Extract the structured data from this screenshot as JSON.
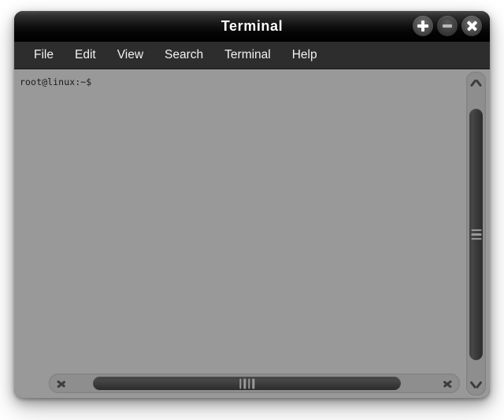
{
  "window": {
    "title": "Terminal",
    "controls": [
      {
        "name": "maximize-button",
        "icon": "plus-icon",
        "label": "+"
      },
      {
        "name": "minimize-button",
        "icon": "minus-icon",
        "label": "−"
      },
      {
        "name": "close-button",
        "icon": "close-icon",
        "label": "✕"
      }
    ]
  },
  "menubar": {
    "items": [
      {
        "label": "File"
      },
      {
        "label": "Edit"
      },
      {
        "label": "View"
      },
      {
        "label": "Search"
      },
      {
        "label": "Terminal"
      },
      {
        "label": "Help"
      }
    ]
  },
  "terminal": {
    "prompt": "root@linux:~$",
    "background_color": "#999999",
    "text_color": "#1b1b1b"
  },
  "scrollbars": {
    "vertical": {
      "up_arrow_icon": "chevron-up-icon",
      "down_arrow_icon": "chevron-down-icon",
      "grip_icon": "grip-horizontal-icon"
    },
    "horizontal": {
      "left_arrow_icon": "chevron-left-icon",
      "right_arrow_icon": "chevron-right-icon",
      "grip_icon": "grip-vertical-icon"
    }
  },
  "theme": {
    "titlebar_color": "#000000",
    "menubar_color": "#2d2d2d",
    "accent_text_color": "#ffffff",
    "scrollbar_trough_color": "#8e8e8e",
    "scrollbar_thumb_color": "#3a3a3a"
  }
}
